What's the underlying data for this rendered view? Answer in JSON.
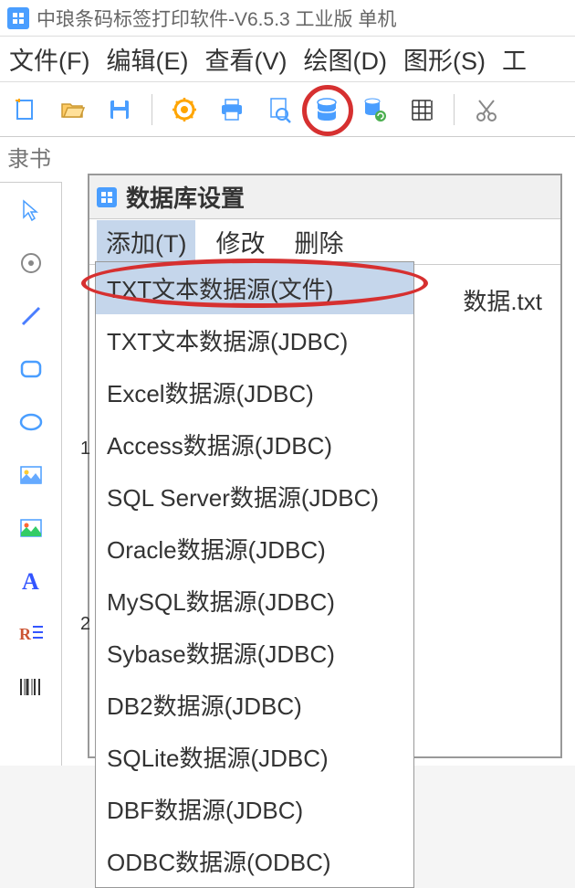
{
  "app": {
    "title": "中琅条码标签打印软件-V6.5.3 工业版 单机"
  },
  "menubar": {
    "items": [
      {
        "label": "文件(F)"
      },
      {
        "label": "编辑(E)"
      },
      {
        "label": "查看(V)"
      },
      {
        "label": "绘图(D)"
      },
      {
        "label": "图形(S)"
      },
      {
        "label": "工"
      }
    ]
  },
  "search": {
    "placeholder": "隶书"
  },
  "dialog": {
    "title": "数据库设置",
    "menu": {
      "add": "添加(T)",
      "modify": "修改",
      "delete": "删除"
    },
    "filename": "数据.txt"
  },
  "dropdown": {
    "items": [
      "TXT文本数据源(文件)",
      "TXT文本数据源(JDBC)",
      "Excel数据源(JDBC)",
      "Access数据源(JDBC)",
      "SQL Server数据源(JDBC)",
      "Oracle数据源(JDBC)",
      "MySQL数据源(JDBC)",
      "Sybase数据源(JDBC)",
      "DB2数据源(JDBC)",
      "SQLite数据源(JDBC)",
      "DBF数据源(JDBC)",
      "ODBC数据源(ODBC)"
    ]
  },
  "ruler": {
    "mark1": "1",
    "mark2": "2"
  }
}
